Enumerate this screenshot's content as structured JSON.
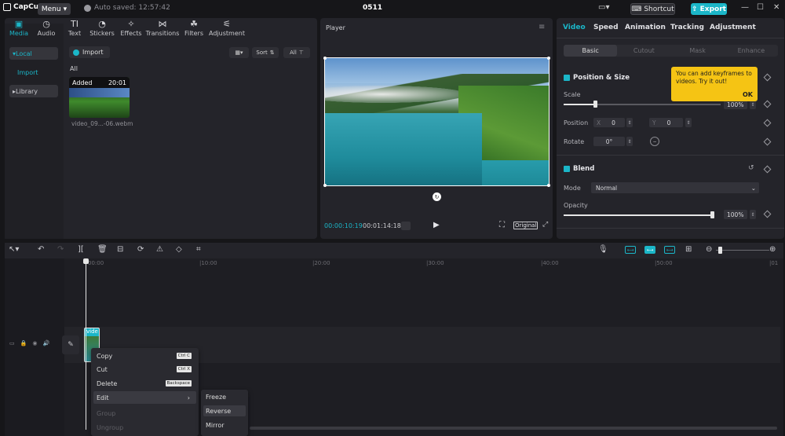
{
  "titlebar": {
    "app_name": "CapCut",
    "menu_label": "Menu",
    "autosave": "Auto saved: 12:57:42",
    "project_title": "0511",
    "shortcut_label": "Shortcut",
    "export_label": "Export"
  },
  "media": {
    "tabs": [
      {
        "label": "Media",
        "icon": "media-icon"
      },
      {
        "label": "Audio",
        "icon": "audio-icon"
      },
      {
        "label": "Text",
        "icon": "text-icon"
      },
      {
        "label": "Stickers",
        "icon": "stickers-icon"
      },
      {
        "label": "Effects",
        "icon": "effects-icon"
      },
      {
        "label": "Transitions",
        "icon": "transitions-icon"
      },
      {
        "label": "Filters",
        "icon": "filters-icon"
      },
      {
        "label": "Adjustment",
        "icon": "adjustment-icon"
      }
    ],
    "side": {
      "local": "Local",
      "import": "Import",
      "library": "Library"
    },
    "import_button": "Import",
    "sort_label": "Sort",
    "filter_label": "All",
    "section_label": "All",
    "clip": {
      "badge": "Added",
      "duration": "20:01",
      "name": "video_09...-06.webm"
    }
  },
  "player": {
    "title": "Player",
    "current_time": "00:00:10:19",
    "total_time": "00:01:14:18",
    "ratio_label": "Original"
  },
  "inspector": {
    "tabs": [
      "Video",
      "Speed",
      "Animation",
      "Tracking",
      "Adjustment"
    ],
    "subtabs": [
      "Basic",
      "Cutout",
      "Mask",
      "Enhance"
    ],
    "position_size": {
      "title": "Position & Size",
      "scale_label": "Scale",
      "scale_value": "100%",
      "scale_fraction": 0.2,
      "position_label": "Position",
      "x_label": "X",
      "x_value": "0",
      "y_label": "Y",
      "y_value": "0",
      "rotate_label": "Rotate",
      "rotate_value": "0°"
    },
    "blend": {
      "title": "Blend",
      "mode_label": "Mode",
      "mode_value": "Normal",
      "opacity_label": "Opacity",
      "opacity_value": "100%",
      "opacity_fraction": 1.0
    },
    "tooltip": {
      "text": "You can add keyframes to videos. Try it out!",
      "ok": "OK"
    }
  },
  "timeline": {
    "ruler": [
      "00:00",
      "|10:00",
      "|20:00",
      "|30:00",
      "|40:00",
      "|50:00",
      "|01"
    ],
    "clip_label": "vide"
  },
  "context_menu": {
    "items": [
      {
        "label": "Copy",
        "shortcut": "Ctrl C",
        "disabled": false
      },
      {
        "label": "Cut",
        "shortcut": "Ctrl X",
        "disabled": false
      },
      {
        "label": "Delete",
        "shortcut": "Backspace",
        "disabled": false
      },
      {
        "label": "Edit",
        "shortcut": "",
        "disabled": false
      },
      {
        "label": "Group",
        "shortcut": "",
        "disabled": true
      },
      {
        "label": "Ungroup",
        "shortcut": "",
        "disabled": true
      }
    ],
    "submenu": [
      "Freeze",
      "Reverse",
      "Mirror"
    ]
  },
  "colors": {
    "accent": "#1bb6c8",
    "tooltip": "#f5c414",
    "panel": "#24242a"
  }
}
